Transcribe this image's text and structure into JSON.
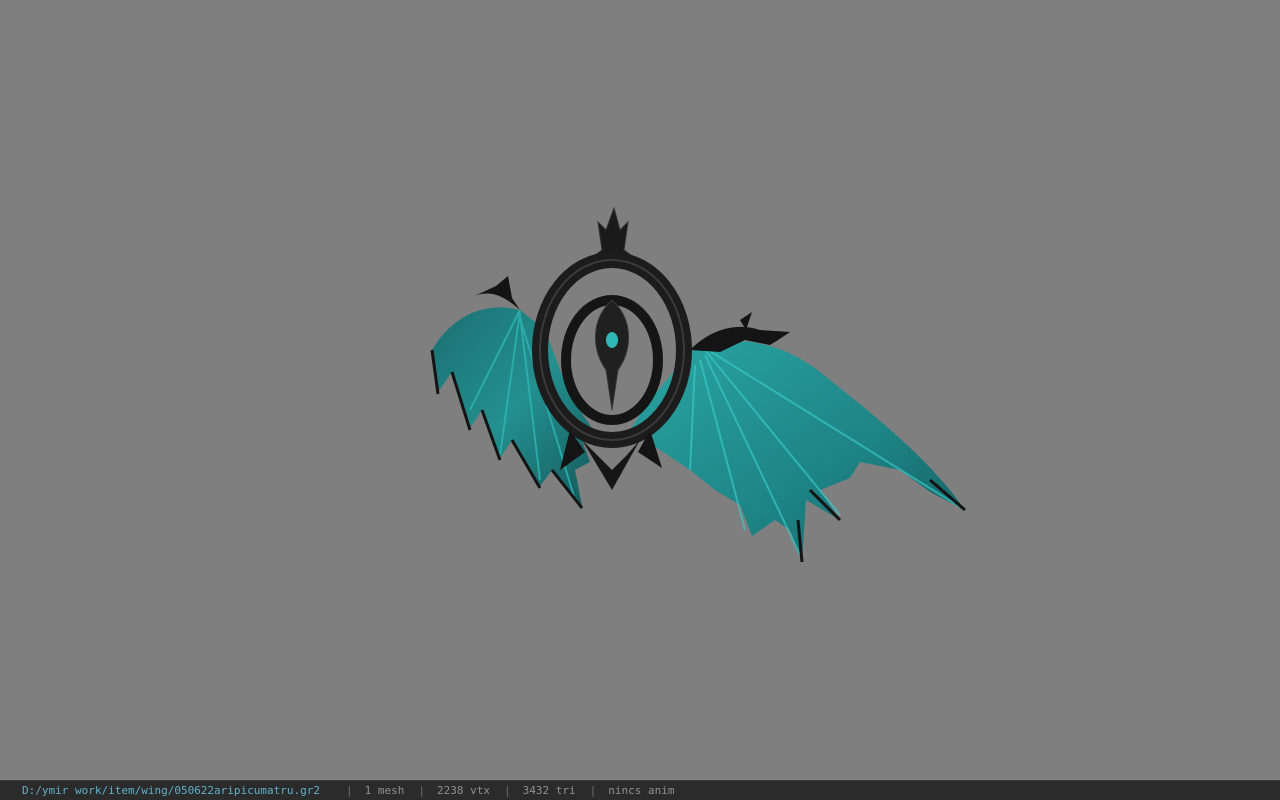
{
  "viewport": {
    "background": "#7f7f7f",
    "model_name": "wing",
    "model_colors": {
      "frame": "#1a1a1a",
      "membrane": "#1f7f80",
      "membrane_highlight": "#2fb8b6"
    }
  },
  "statusbar": {
    "file_path": "D:/ymir work/item/wing/050622aripicumatru.gr2",
    "separator": "|",
    "mesh_count": "1 mesh",
    "vertex_count": "2238 vtx",
    "triangle_count": "3432 tri",
    "animation": "nincs anim"
  }
}
